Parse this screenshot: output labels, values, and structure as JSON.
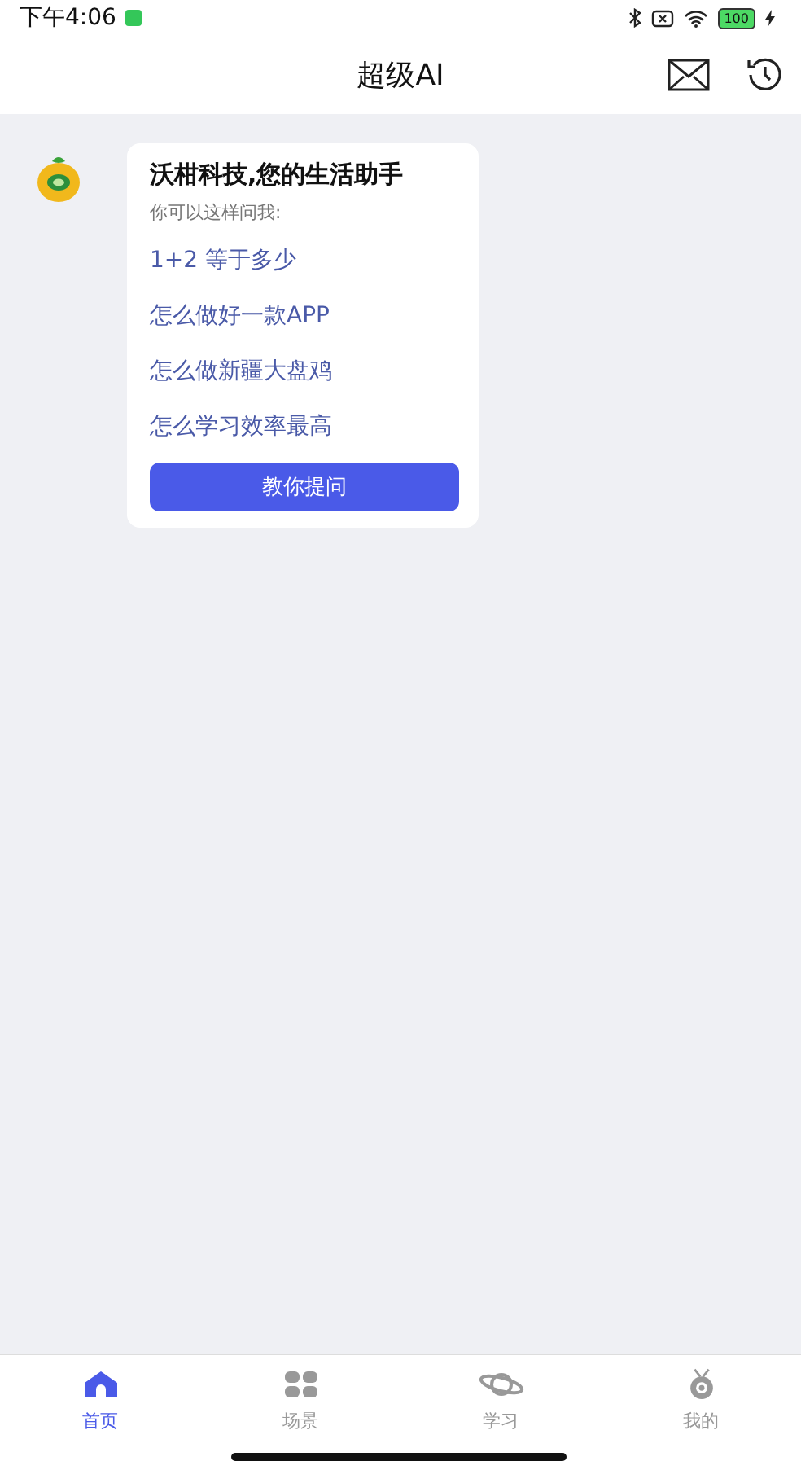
{
  "status_bar": {
    "time": "下午4:06",
    "battery": "100"
  },
  "header": {
    "title": "超级AI"
  },
  "welcome": {
    "title": "沃柑科技,您的生活助手",
    "subtitle": "你可以这样问我:",
    "suggestions": [
      "1+2 等于多少",
      "怎么做好一款APP",
      "怎么做新疆大盘鸡",
      "怎么学习效率最高"
    ],
    "button": "教你提问"
  },
  "tabs": [
    {
      "label": "首页",
      "selected": true
    },
    {
      "label": "场景",
      "selected": false
    },
    {
      "label": "学习",
      "selected": false
    },
    {
      "label": "我的",
      "selected": false
    }
  ]
}
